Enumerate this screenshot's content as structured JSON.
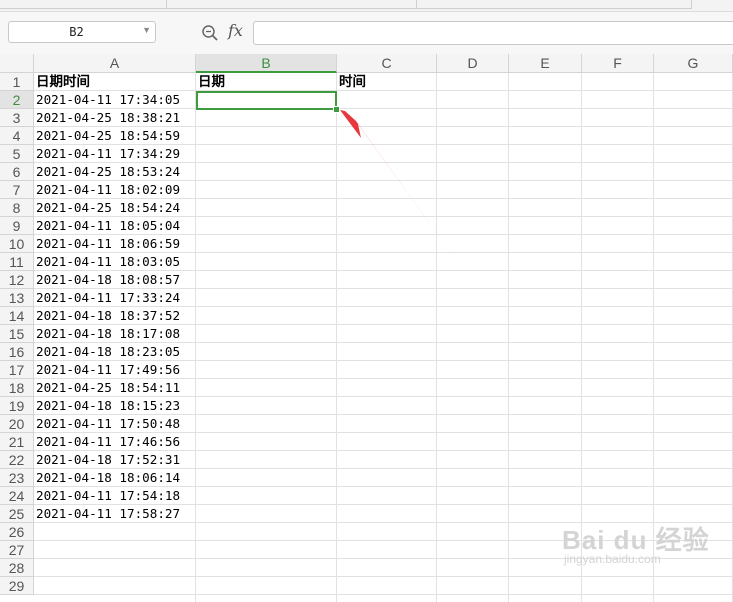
{
  "formula_bar": {
    "name_box": "B2",
    "fx_label": "fx",
    "formula_value": ""
  },
  "columns": [
    "A",
    "B",
    "C",
    "D",
    "E",
    "F",
    "G"
  ],
  "active_cell": "B2",
  "rows": [
    {
      "n": "1",
      "a": "日期时间",
      "b": "日期",
      "c": "时间"
    },
    {
      "n": "2",
      "a": "2021-04-11 17:34:05",
      "b": "",
      "c": ""
    },
    {
      "n": "3",
      "a": "2021-04-25 18:38:21",
      "b": "",
      "c": ""
    },
    {
      "n": "4",
      "a": "2021-04-25 18:54:59",
      "b": "",
      "c": ""
    },
    {
      "n": "5",
      "a": "2021-04-11 17:34:29",
      "b": "",
      "c": ""
    },
    {
      "n": "6",
      "a": "2021-04-25 18:53:24",
      "b": "",
      "c": ""
    },
    {
      "n": "7",
      "a": "2021-04-11 18:02:09",
      "b": "",
      "c": ""
    },
    {
      "n": "8",
      "a": "2021-04-25 18:54:24",
      "b": "",
      "c": ""
    },
    {
      "n": "9",
      "a": "2021-04-11 18:05:04",
      "b": "",
      "c": ""
    },
    {
      "n": "10",
      "a": "2021-04-11 18:06:59",
      "b": "",
      "c": ""
    },
    {
      "n": "11",
      "a": "2021-04-11 18:03:05",
      "b": "",
      "c": ""
    },
    {
      "n": "12",
      "a": "2021-04-18 18:08:57",
      "b": "",
      "c": ""
    },
    {
      "n": "13",
      "a": "2021-04-11 17:33:24",
      "b": "",
      "c": ""
    },
    {
      "n": "14",
      "a": "2021-04-18 18:37:52",
      "b": "",
      "c": ""
    },
    {
      "n": "15",
      "a": "2021-04-18 18:17:08",
      "b": "",
      "c": ""
    },
    {
      "n": "16",
      "a": "2021-04-18 18:23:05",
      "b": "",
      "c": ""
    },
    {
      "n": "17",
      "a": "2021-04-11 17:49:56",
      "b": "",
      "c": ""
    },
    {
      "n": "18",
      "a": "2021-04-25 18:54:11",
      "b": "",
      "c": ""
    },
    {
      "n": "19",
      "a": "2021-04-18 18:15:23",
      "b": "",
      "c": ""
    },
    {
      "n": "20",
      "a": "2021-04-11 17:50:48",
      "b": "",
      "c": ""
    },
    {
      "n": "21",
      "a": "2021-04-11 17:46:56",
      "b": "",
      "c": ""
    },
    {
      "n": "22",
      "a": "2021-04-18 17:52:31",
      "b": "",
      "c": ""
    },
    {
      "n": "23",
      "a": "2021-04-18 18:06:14",
      "b": "",
      "c": ""
    },
    {
      "n": "24",
      "a": "2021-04-11 17:54:18",
      "b": "",
      "c": ""
    },
    {
      "n": "25",
      "a": "2021-04-11 17:58:27",
      "b": "",
      "c": ""
    },
    {
      "n": "26",
      "a": "",
      "b": "",
      "c": ""
    },
    {
      "n": "27",
      "a": "",
      "b": "",
      "c": ""
    },
    {
      "n": "28",
      "a": "",
      "b": "",
      "c": ""
    },
    {
      "n": "29",
      "a": "",
      "b": "",
      "c": ""
    }
  ],
  "annotation": {
    "color": "#e8383d",
    "icon": "red-arrow"
  },
  "accent_color": "#3f9b3f",
  "watermark": {
    "brand": "Bai du 经验",
    "url": "jingyan.baidu.com"
  }
}
